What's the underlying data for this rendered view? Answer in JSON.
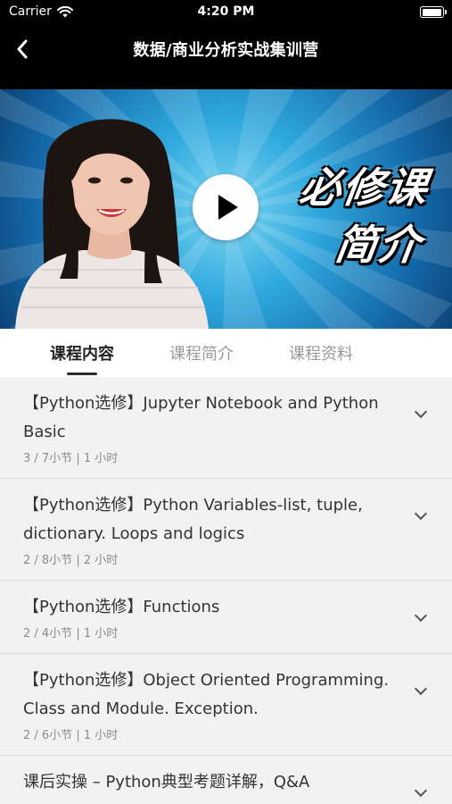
{
  "status": {
    "carrier": "Carrier",
    "time": "4:20 PM",
    "battery_level": 0.95
  },
  "nav": {
    "title": "数据/商业分析实战集训营",
    "back_icon": "chevron-left-icon"
  },
  "video": {
    "promo_line1": "必修课",
    "promo_line2": "简介",
    "play_icon": "play-icon"
  },
  "tabs": [
    {
      "label": "课程内容",
      "active": true
    },
    {
      "label": "课程简介",
      "active": false
    },
    {
      "label": "课程资料",
      "active": false
    }
  ],
  "sections": [
    {
      "title": "【Python选修】Jupyter Notebook and Python Basic",
      "meta": "3 / 7小节 | 1 小时"
    },
    {
      "title": "【Python选修】Python Variables-list, tuple, dictionary.  Loops and logics",
      "meta": "2 / 8小节 | 2 小时"
    },
    {
      "title": "【Python选修】Functions",
      "meta": "2 / 4小节 | 1 小时"
    },
    {
      "title": "【Python选修】Object Oriented Programming. Class and Module. Exception.",
      "meta": "2 / 6小节 | 1 小时"
    },
    {
      "title": "课后实操 – Python典型考题详解，Q&A",
      "meta": ""
    }
  ],
  "colors": {
    "nav_bg": "#000000",
    "list_bg": "#f2f2f2",
    "video_blue": "#2fa8de"
  }
}
